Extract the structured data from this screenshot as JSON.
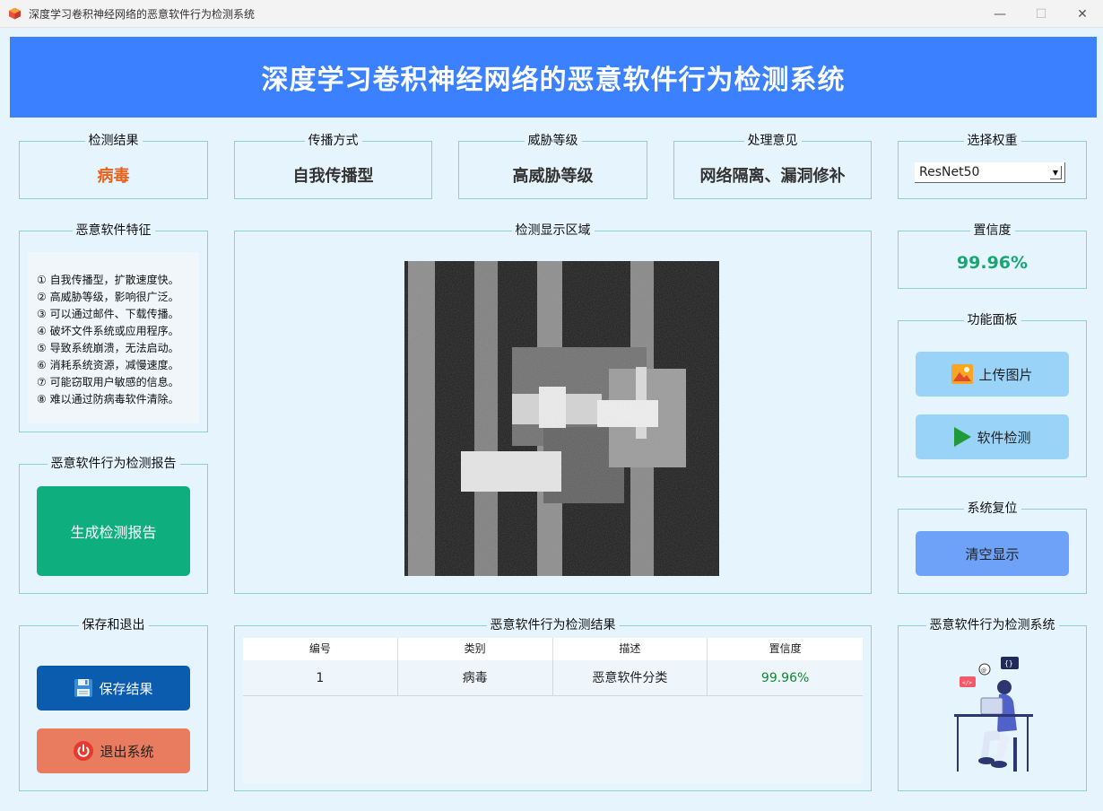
{
  "window": {
    "title": "深度学习卷积神经网络的恶意软件行为检测系统",
    "min_glyph": "—",
    "max_glyph": "☐",
    "close_glyph": "✕"
  },
  "banner": {
    "title": "深度学习卷积神经网络的恶意软件行为检测系统"
  },
  "result_cards": {
    "detection": {
      "title": "检测结果",
      "value": "病毒"
    },
    "propagation": {
      "title": "传播方式",
      "value": "自我传播型"
    },
    "threat": {
      "title": "威胁等级",
      "value": "高威胁等级"
    },
    "advice": {
      "title": "处理意见",
      "value": "网络隔离、漏洞修补"
    }
  },
  "weights": {
    "title": "选择权重",
    "selected": "ResNet50",
    "arrow": "▼"
  },
  "features": {
    "title": "恶意软件特征",
    "items": [
      "① 自我传播型，扩散速度快。",
      "② 高威胁等级，影响很广泛。",
      "③ 可以通过邮件、下载传播。",
      "④ 破坏文件系统或应用程序。",
      "⑤ 导致系统崩溃，无法启动。",
      "⑥ 消耗系统资源，减慢速度。",
      "⑦ 可能窃取用户敏感的信息。",
      "⑧ 难以通过防病毒软件清除。"
    ]
  },
  "report": {
    "title": "恶意软件行为检测报告",
    "button": "生成检测报告"
  },
  "display": {
    "title": "检测显示区域"
  },
  "confidence": {
    "title": "置信度",
    "value": "99.96%"
  },
  "panel": {
    "title": "功能面板",
    "upload": "上传图片",
    "detect": "软件检测"
  },
  "reset": {
    "title": "系统复位",
    "clear": "清空显示"
  },
  "save_exit": {
    "title": "保存和退出",
    "save": "保存结果",
    "exit": "退出系统"
  },
  "results_table": {
    "title": "恶意软件行为检测结果",
    "headers": [
      "编号",
      "类别",
      "描述",
      "置信度"
    ],
    "rows": [
      [
        "1",
        "病毒",
        "恶意软件分类",
        "99.96%"
      ]
    ]
  },
  "system_card": {
    "title": "恶意软件行为检测系统"
  },
  "colors": {
    "banner": "#3a80ff",
    "detection_value": "#e8601c",
    "confidence_value": "#1aa672",
    "report_button": "#0fae7e",
    "save_button": "#0b5cae",
    "exit_button": "#e97c5e"
  }
}
